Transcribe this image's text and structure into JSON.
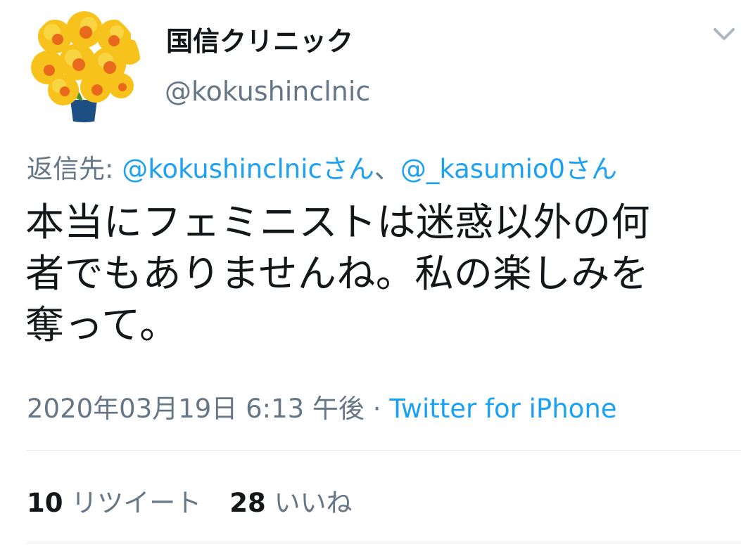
{
  "profile": {
    "display_name": "国信クリニック",
    "handle": "@kokushinclnic",
    "avatar_icon": "daffodil-avatar"
  },
  "header": {
    "menu_icon": "chevron-down-icon"
  },
  "reply": {
    "prefix": "返信先: ",
    "to_1": "@kokushinclnicさん",
    "separator": "、",
    "to_2": "@_kasumio0さん"
  },
  "tweet": {
    "text": "本当にフェミニストは迷惑以外の何\n者でもありませんね。私の楽しみを\n奪って。"
  },
  "meta": {
    "timestamp": "2020年03月19日 6:13 午後",
    "separator": " · ",
    "source": "Twitter for iPhone"
  },
  "stats": {
    "retweets_count": "10",
    "retweets_label": " リツイート",
    "likes_count": "28",
    "likes_label": " いいね"
  },
  "colors": {
    "link": "#1da1f2",
    "secondary_text": "#657786",
    "primary_text": "#14171a",
    "divider": "#e1e8ed"
  }
}
